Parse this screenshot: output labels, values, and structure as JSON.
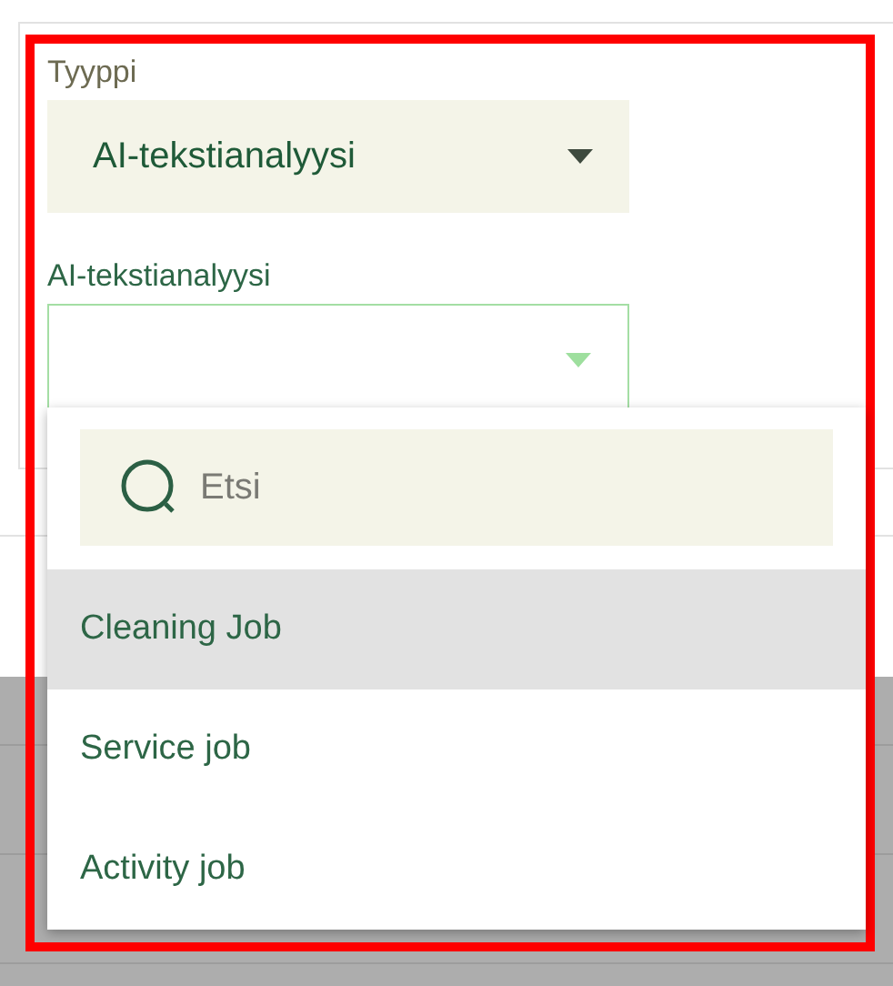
{
  "type_field": {
    "label": "Tyyppi",
    "value": "AI-tekstianalyysi",
    "open": false
  },
  "analysis_field": {
    "label": "AI-tekstianalyysi",
    "open": true
  },
  "dropdown": {
    "search": {
      "placeholder": "Etsi"
    },
    "options": [
      {
        "label": "Cleaning Job",
        "selected": true
      },
      {
        "label": "Service job",
        "selected": false
      },
      {
        "label": "Activity job",
        "selected": false
      }
    ]
  },
  "highlight_frame": true
}
